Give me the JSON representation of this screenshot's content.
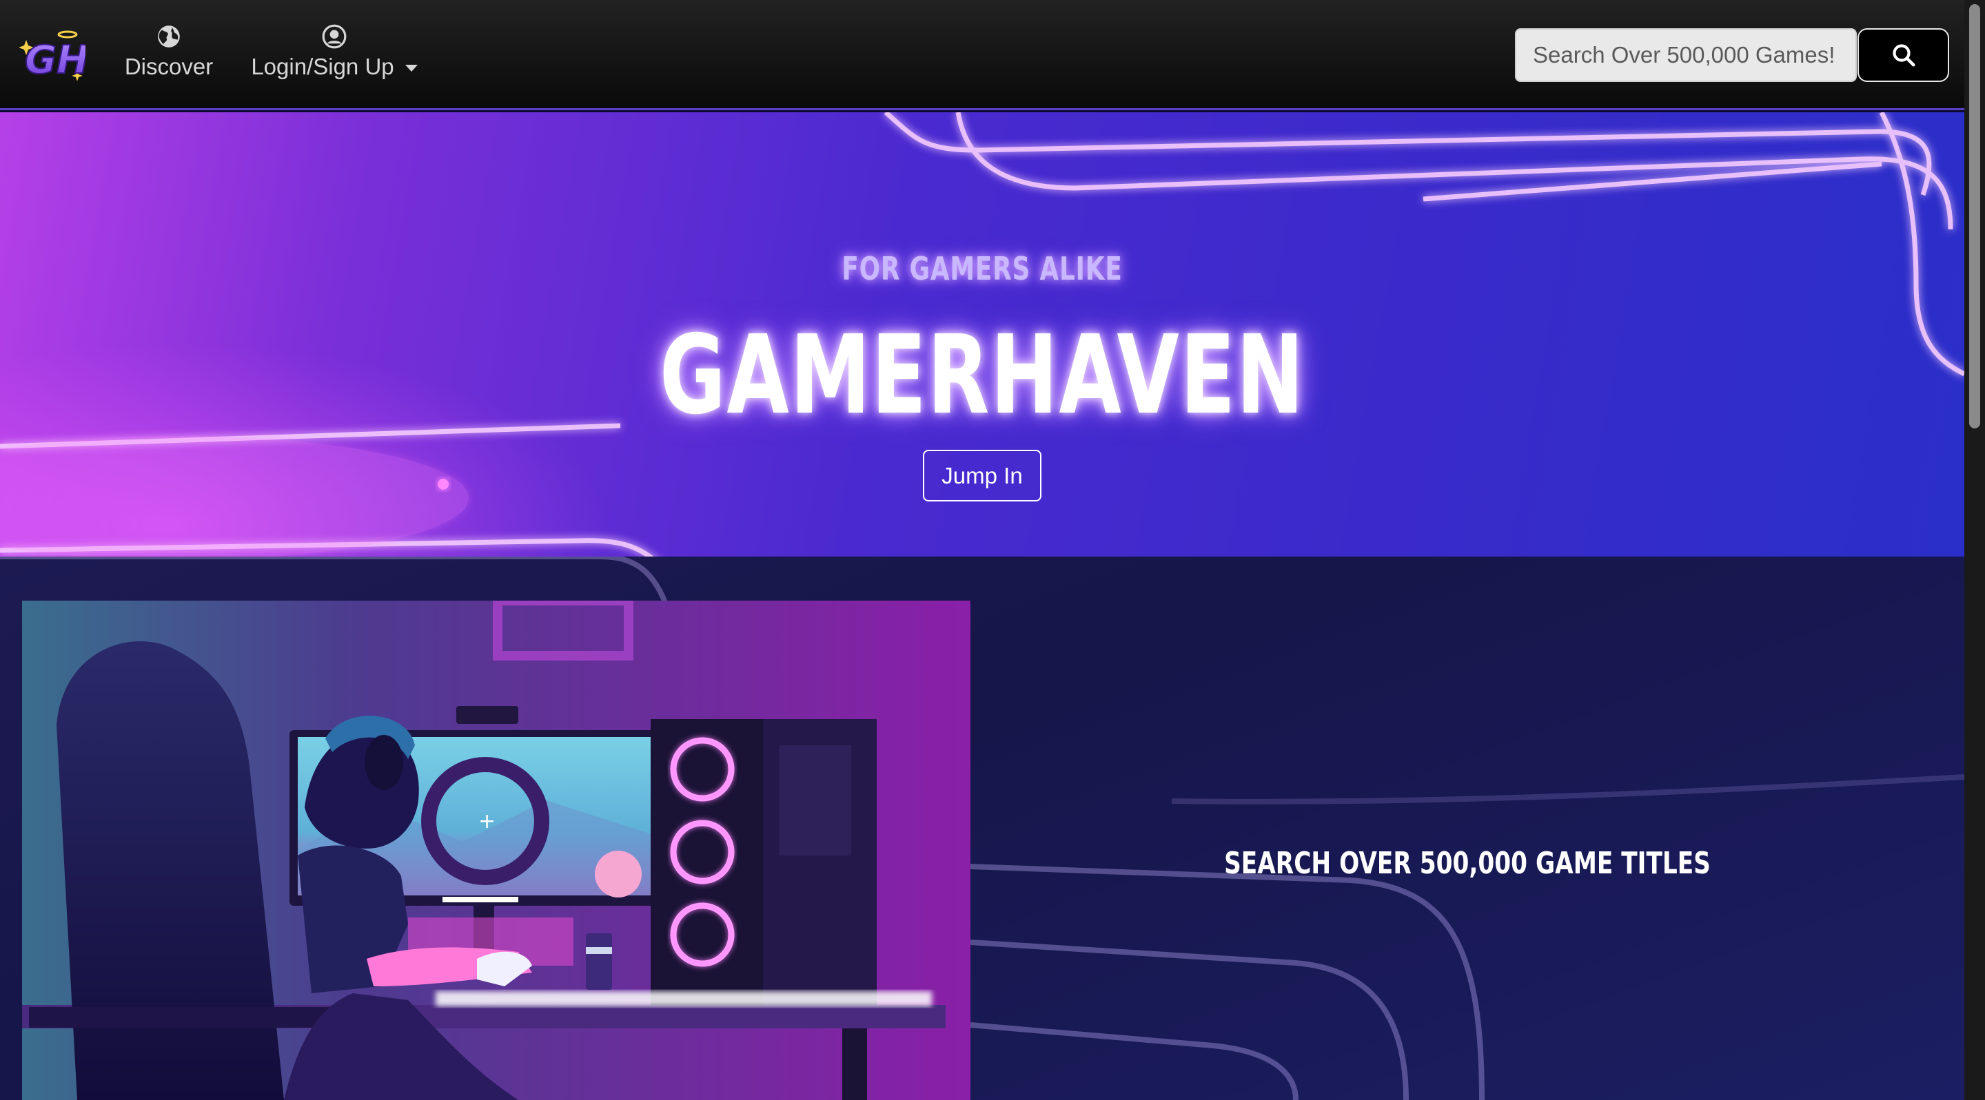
{
  "nav": {
    "brand_text": "GH",
    "discover_label": "Discover",
    "login_label": "Login/Sign Up",
    "search_placeholder": "Search Over 500,000 Games!"
  },
  "hero": {
    "subtitle": "FOR GAMERS ALIKE",
    "title": "GAMERHAVEN",
    "cta_label": "Jump In"
  },
  "section2": {
    "heading": "SEARCH OVER 500,000 GAME TITLES"
  },
  "colors": {
    "accent": "#7b3fe4",
    "hero_glow": "#d8a8ff",
    "navbar": "#111111"
  },
  "icons": {
    "discover": "globe-icon",
    "login": "user-circle-icon",
    "search": "search-icon",
    "menu": "caret-down-icon"
  }
}
